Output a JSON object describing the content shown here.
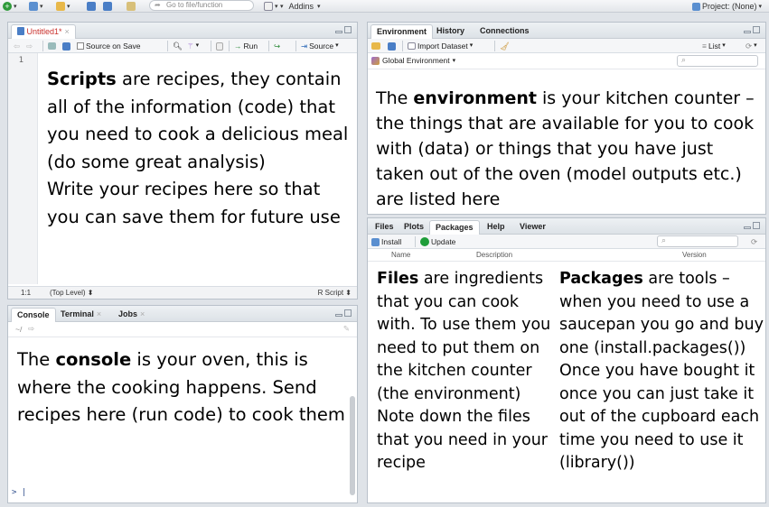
{
  "topbar": {
    "goto_placeholder": "Go to file/function",
    "addins_label": "Addins",
    "project_label": "Project: (None)"
  },
  "source_pane": {
    "tab_label": "Untitled1*",
    "source_on_save": "Source on Save",
    "run_label": "Run",
    "source_label": "Source",
    "line_number": "1",
    "status_pos": "1:1",
    "status_scope": "(Top Level)",
    "status_type": "R Script",
    "note_bold": "Scripts",
    "note_text": " are recipes,  they contain all of the information (code) that you need to cook a delicious meal (do some great analysis)",
    "note_text2": "Write your recipes here so that you can save them for future use"
  },
  "console_pane": {
    "tabs": [
      "Console",
      "Terminal",
      "Jobs"
    ],
    "path": "~/",
    "prompt": ">",
    "note_pre": "The ",
    "note_bold": "console",
    "note_text": " is your oven, this is where the cooking happens.  Send recipes here (run code) to cook them"
  },
  "env_pane": {
    "tabs": [
      "Environment",
      "History",
      "Connections"
    ],
    "import_label": "Import Dataset",
    "list_label": "List",
    "global_env": "Global Environment",
    "note_pre": "The ",
    "note_bold": "environment",
    "note_text": " is your kitchen counter – the things that are available for you to cook with (data) or things that you have just taken out of the oven (model outputs etc.) are listed here"
  },
  "files_pane": {
    "tabs": [
      "Files",
      "Plots",
      "Packages",
      "Help",
      "Viewer"
    ],
    "install_label": "Install",
    "update_label": "Update",
    "col_name": "Name",
    "col_desc": "Description",
    "col_version": "Version",
    "files_bold": "Files",
    "files_text": " are ingredients that you can cook with. To use them you need to put them on the kitchen counter (the environment)",
    "files_text2": "Note down the files that you need in your recipe",
    "pkg_bold": "Packages",
    "pkg_text": " are tools – when you need to use a saucepan you go and buy one (install.packages())",
    "pkg_text2": "Once you have bought it once you can just take it out of the cupboard each time you need to use it (library())"
  },
  "colors": {
    "accent_red": "#c9302c",
    "run_green": "#2e8b3a",
    "update_green": "#1f9d3a"
  }
}
